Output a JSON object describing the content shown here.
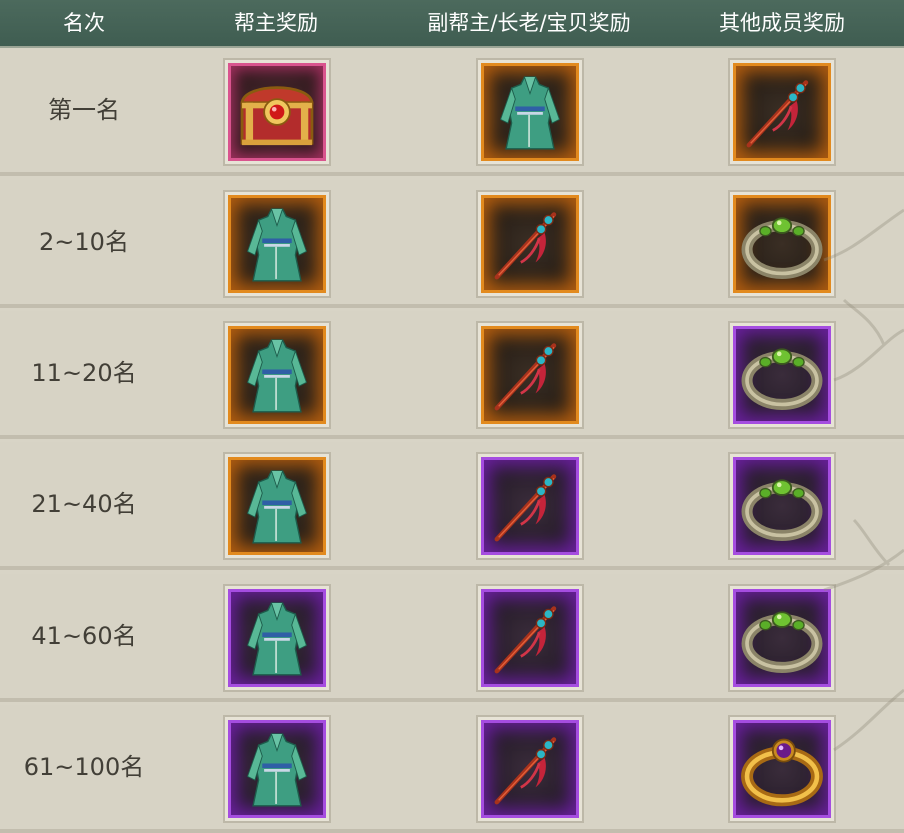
{
  "header": {
    "col_rank": "名次",
    "col_leader": "帮主奖励",
    "col_deputy": "副帮主/长老/宝贝奖励",
    "col_member": "其他成员奖励"
  },
  "rows": [
    {
      "rank": "第一名",
      "leader": {
        "item": "treasure-chest-icon",
        "quality": "pink"
      },
      "deputy": {
        "item": "robe-icon",
        "quality": "orange"
      },
      "member": {
        "item": "hairpin-icon",
        "quality": "orange"
      }
    },
    {
      "rank": "2~10名",
      "leader": {
        "item": "robe-icon",
        "quality": "orange"
      },
      "deputy": {
        "item": "hairpin-icon",
        "quality": "orange"
      },
      "member": {
        "item": "jade-ring-icon",
        "quality": "orange"
      }
    },
    {
      "rank": "11~20名",
      "leader": {
        "item": "robe-icon",
        "quality": "orange"
      },
      "deputy": {
        "item": "hairpin-icon",
        "quality": "orange"
      },
      "member": {
        "item": "jade-ring-icon",
        "quality": "purple"
      }
    },
    {
      "rank": "21~40名",
      "leader": {
        "item": "robe-icon",
        "quality": "orange"
      },
      "deputy": {
        "item": "hairpin-icon",
        "quality": "purple"
      },
      "member": {
        "item": "jade-ring-icon",
        "quality": "purple"
      }
    },
    {
      "rank": "41~60名",
      "leader": {
        "item": "robe-icon",
        "quality": "purple"
      },
      "deputy": {
        "item": "hairpin-icon",
        "quality": "purple"
      },
      "member": {
        "item": "jade-ring-icon",
        "quality": "purple"
      }
    },
    {
      "rank": "61~100名",
      "leader": {
        "item": "robe-icon",
        "quality": "purple"
      },
      "deputy": {
        "item": "hairpin-icon",
        "quality": "purple"
      },
      "member": {
        "item": "gold-amethyst-ring-icon",
        "quality": "purple"
      }
    }
  ],
  "colors": {
    "header_bg": "#466356",
    "row_bg": "#d7d3c5",
    "text": "#423f37",
    "orange_frame": "#e28a1e",
    "purple_frame": "#a54de0",
    "pink_frame": "#d9548e"
  }
}
